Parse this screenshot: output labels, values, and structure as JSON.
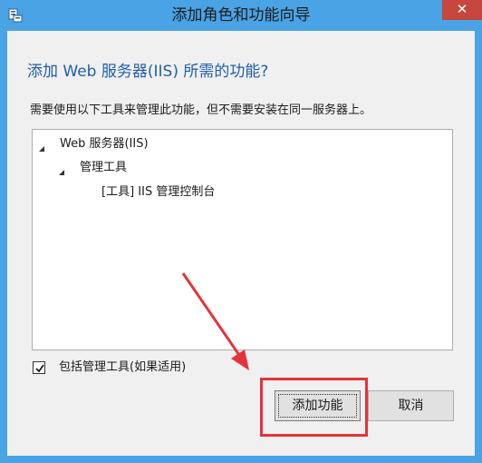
{
  "window": {
    "title": "添加角色和功能向导",
    "close_glyph": "✕"
  },
  "dialog": {
    "heading": "添加 Web 服务器(IIS) 所需的功能?",
    "description": "需要使用以下工具来管理此功能，但不需要安装在同一服务器上。"
  },
  "tree": {
    "items": [
      {
        "label": "Web 服务器(IIS)",
        "level": 0,
        "expanded": true
      },
      {
        "label": "管理工具",
        "level": 1,
        "expanded": true
      },
      {
        "label": "[工具] IIS 管理控制台",
        "level": 2,
        "expanded": false
      }
    ]
  },
  "options": {
    "include_tools_label": "包括管理工具(如果适用)",
    "include_tools_checked": true
  },
  "buttons": {
    "add_label": "添加功能",
    "cancel_label": "取消"
  },
  "annotation": {
    "highlight_color": "#e2343a",
    "arrow_icon": "red-arrow-icon"
  },
  "colors": {
    "title_bar": "#4aa3e4",
    "heading_text": "#1f5fa6",
    "close_button": "#c8473c"
  }
}
